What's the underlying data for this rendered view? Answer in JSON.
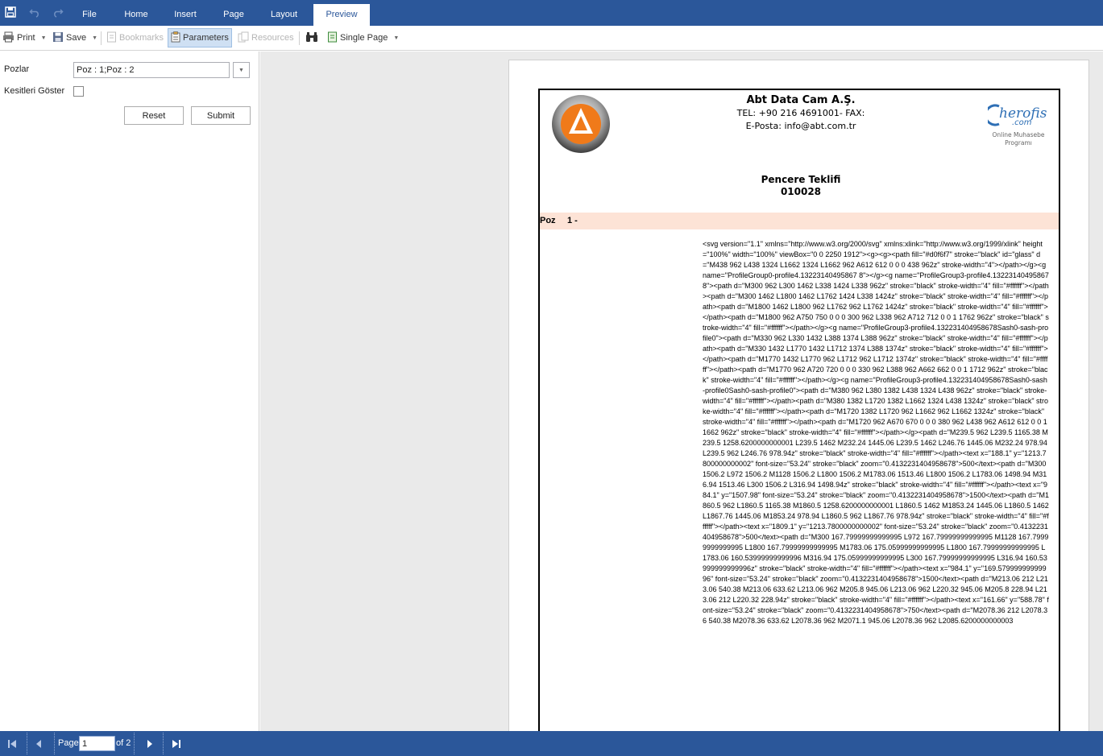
{
  "ribbon": {
    "tabs": [
      "File",
      "Home",
      "Insert",
      "Page",
      "Layout",
      "Preview"
    ],
    "active_tab": "Preview"
  },
  "toolbar": {
    "print_label": "Print",
    "save_label": "Save",
    "bookmarks_label": "Bookmarks",
    "parameters_label": "Parameters",
    "resources_label": "Resources",
    "view_mode_label": "Single Page"
  },
  "parameters": {
    "pozlar_label": "Pozlar",
    "pozlar_value": "Poz : 1;Poz : 2",
    "kesitleri_label": "Kesitleri Göster",
    "kesitleri_checked": false,
    "reset_label": "Reset",
    "submit_label": "Submit"
  },
  "report": {
    "company_name": "Abt Data Cam A.Ş.",
    "phone_line": "TEL: +90 216 4691001- FAX:",
    "email_line": "E-Posta: info@abt.com.tr",
    "right_logo_main": "herofis",
    "right_logo_com": ".com",
    "right_logo_line1": "Online Muhasebe",
    "right_logo_line2": "Programı",
    "document_title": "Pencere Teklifi",
    "document_number": "010028",
    "poz_label": "Poz",
    "poz_value": "1 -",
    "svg_markup_text": "<svg version=\"1.1\" xmlns=\"http://www.w3.org/2000/svg\" xmlns:xlink=\"http://www.w3.org/1999/xlink\" height=\"100%\" width=\"100%\" viewBox=\"0 0 2250 1912\"><g><g><path fill=\"#d0f6f7\" stroke=\"black\" id=\"glass\" d=\"M438 962 L438 1324 L1662 1324 L1662 962 A612 612 0 0 0 438 962z\" stroke-width=\"4\"></path></g><g name=\"ProfileGroup0-profile4.13223140495867 8\"></g><g name=\"ProfileGroup3-profile4.132231404958678\"><path d=\"M300 962 L300 1462 L338 1424 L338 962z\" stroke=\"black\" stroke-width=\"4\" fill=\"#ffffff\"></path><path d=\"M300 1462 L1800 1462 L1762 1424 L338 1424z\" stroke=\"black\" stroke-width=\"4\" fill=\"#ffffff\"></path><path d=\"M1800 1462 L1800 962 L1762 962 L1762 1424z\" stroke=\"black\" stroke-width=\"4\" fill=\"#ffffff\"></path><path d=\"M1800 962 A750 750 0 0 0 300 962 L338 962 A712 712 0 0 1 1762 962z\" stroke=\"black\" stroke-width=\"4\" fill=\"#ffffff\"></path></g><g name=\"ProfileGroup3-profile4.132231404958678Sash0-sash-profile0\"><path d=\"M330 962 L330 1432 L388 1374 L388 962z\" stroke=\"black\" stroke-width=\"4\" fill=\"#ffffff\"></path><path d=\"M330 1432 L1770 1432 L1712 1374 L388 1374z\" stroke=\"black\" stroke-width=\"4\" fill=\"#ffffff\"></path><path d=\"M1770 1432 L1770 962 L1712 962 L1712 1374z\" stroke=\"black\" stroke-width=\"4\" fill=\"#ffffff\"></path><path d=\"M1770 962 A720 720 0 0 0 330 962 L388 962 A662 662 0 0 1 1712 962z\" stroke=\"black\" stroke-width=\"4\" fill=\"#ffffff\"></path></g><g name=\"ProfileGroup3-profile4.132231404958678Sash0-sash-profile0Sash0-sash-profile0\"><path d=\"M380 962 L380 1382 L438 1324 L438 962z\" stroke=\"black\" stroke-width=\"4\" fill=\"#ffffff\"></path><path d=\"M380 1382 L1720 1382 L1662 1324 L438 1324z\" stroke=\"black\" stroke-width=\"4\" fill=\"#ffffff\"></path><path d=\"M1720 1382 L1720 962 L1662 962 L1662 1324z\" stroke=\"black\" stroke-width=\"4\" fill=\"#ffffff\"></path><path d=\"M1720 962 A670 670 0 0 0 380 962 L438 962 A612 612 0 0 1 1662 962z\" stroke=\"black\" stroke-width=\"4\" fill=\"#ffffff\"></path></g><path d=\"M239.5 962 L239.5 1165.38 M239.5 1258.6200000000001 L239.5 1462 M232.24 1445.06 L239.5 1462 L246.76 1445.06 M232.24 978.94 L239.5 962 L246.76 978.94z\" stroke=\"black\" stroke-width=\"4\" fill=\"#ffffff\"></path><text x=\"188.1\" y=\"1213.7800000000002\" font-size=\"53.24\" stroke=\"black\" zoom=\"0.4132231404958678\">500</text><path d=\"M300 1506.2 L972 1506.2 M1128 1506.2 L1800 1506.2 M1783.06 1513.46 L1800 1506.2 L1783.06 1498.94 M316.94 1513.46 L300 1506.2 L316.94 1498.94z\" stroke=\"black\" stroke-width=\"4\" fill=\"#ffffff\"></path><text x=\"984.1\" y=\"1507.98\" font-size=\"53.24\" stroke=\"black\" zoom=\"0.4132231404958678\">1500</text><path d=\"M1860.5 962 L1860.5 1165.38 M1860.5 1258.6200000000001 L1860.5 1462 M1853.24 1445.06 L1860.5 1462 L1867.76 1445.06 M1853.24 978.94 L1860.5 962 L1867.76 978.94z\" stroke=\"black\" stroke-width=\"4\" fill=\"#ffffff\"></path><text x=\"1809.1\" y=\"1213.7800000000002\" font-size=\"53.24\" stroke=\"black\" zoom=\"0.4132231404958678\">500</text><path d=\"M300 167.79999999999995 L972 167.79999999999995 M1128 167.79999999999995 L1800 167.79999999999995 M1783.06 175.05999999999995 L1800 167.79999999999995 L1783.06 160.53999999999996 M316.94 175.05999999999995 L300 167.79999999999995 L316.94 160.53999999999996z\" stroke=\"black\" stroke-width=\"4\" fill=\"#ffffff\"></path><text x=\"984.1\" y=\"169.57999999999996\" font-size=\"53.24\" stroke=\"black\" zoom=\"0.4132231404958678\">1500</text><path d=\"M213.06 212 L213.06 540.38 M213.06 633.62 L213.06 962 M205.8 945.06 L213.06 962 L220.32 945.06 M205.8 228.94 L213.06 212 L220.32 228.94z\" stroke=\"black\" stroke-width=\"4\" fill=\"#ffffff\"></path><text x=\"161.66\" y=\"588.78\" font-size=\"53.24\" stroke=\"black\" zoom=\"0.4132231404958678\">750</text><path d=\"M2078.36 212 L2078.36 540.38 M2078.36 633.62 L2078.36 962 M2071.1 945.06 L2078.36 962 L2085.6200000000003"
  },
  "pager": {
    "page_label": "Page",
    "current_page": "1",
    "of_label": "of 2"
  },
  "colors": {
    "ribbon_blue": "#2b579a",
    "poz_bar": "#fde3d6",
    "checked_button": "#cfe0f3"
  }
}
